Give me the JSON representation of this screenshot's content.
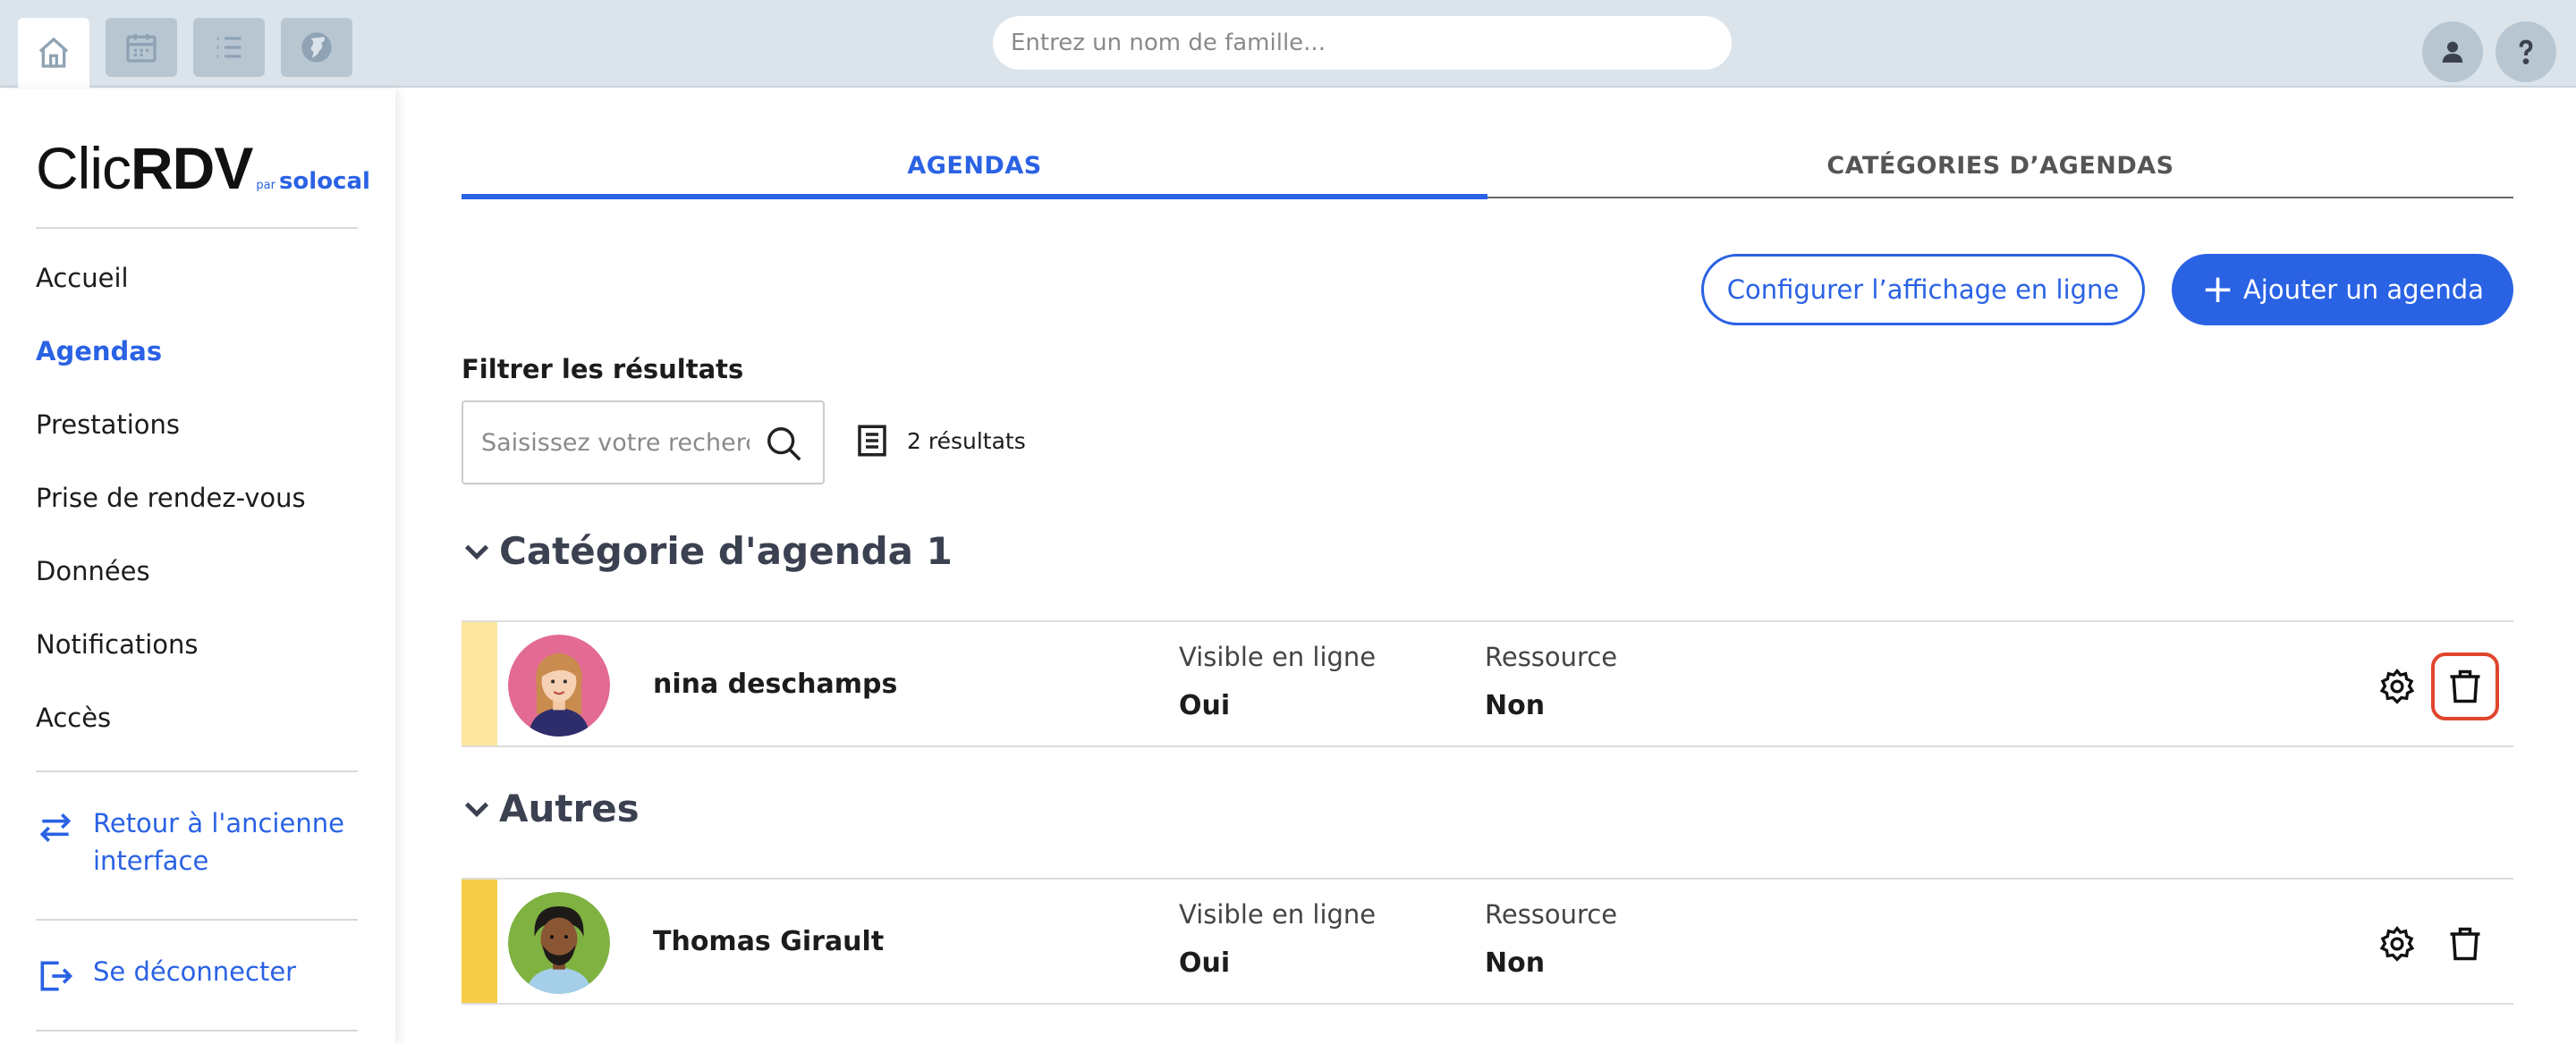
{
  "topbar": {
    "nav": [
      {
        "icon": "home-icon"
      },
      {
        "icon": "calendar-icon"
      },
      {
        "icon": "list-icon"
      },
      {
        "icon": "globe-icon"
      }
    ],
    "search_placeholder": "Entrez un nom de famille...",
    "right_icons": [
      "user-icon",
      "help-icon"
    ]
  },
  "sidebar": {
    "logo": {
      "clic": "Clic",
      "rdv": "RDV",
      "par": "par",
      "solocal": "solocal"
    },
    "items": [
      {
        "label": "Accueil"
      },
      {
        "label": "Agendas",
        "active": true
      },
      {
        "label": "Prestations"
      },
      {
        "label": "Prise de rendez-vous"
      },
      {
        "label": "Données"
      },
      {
        "label": "Notifications"
      },
      {
        "label": "Accès"
      }
    ],
    "old_interface": {
      "line1": "Retour à l'ancienne",
      "line2": "interface"
    },
    "logout": "Se déconnecter"
  },
  "tabs": [
    {
      "label": "AGENDAS",
      "active": true
    },
    {
      "label": "CATÉGORIES D’AGENDAS",
      "active": false
    }
  ],
  "actions": {
    "configure": "Configurer l’affichage en ligne",
    "add_plus": "+",
    "add": "Ajouter un agenda"
  },
  "filter": {
    "label": "Filtrer les résultats",
    "placeholder": "Saisissez votre recherche",
    "results": "2 résultats"
  },
  "groups": [
    {
      "title": "Catégorie d'agenda 1",
      "rows": [
        {
          "name": "nina deschamps",
          "visible_label": "Visible en ligne",
          "visible_value": "Oui",
          "resource_label": "Ressource",
          "resource_value": "Non",
          "bar_color": "#fde7a1"
        }
      ]
    },
    {
      "title": "Autres",
      "rows": [
        {
          "name": "Thomas Girault",
          "visible_label": "Visible en ligne",
          "visible_value": "Oui",
          "resource_label": "Ressource",
          "resource_value": "Non",
          "bar_color": "#f7cd48"
        }
      ]
    }
  ],
  "colors": {
    "accent": "#2a62e4",
    "highlight": "#e0452d"
  }
}
